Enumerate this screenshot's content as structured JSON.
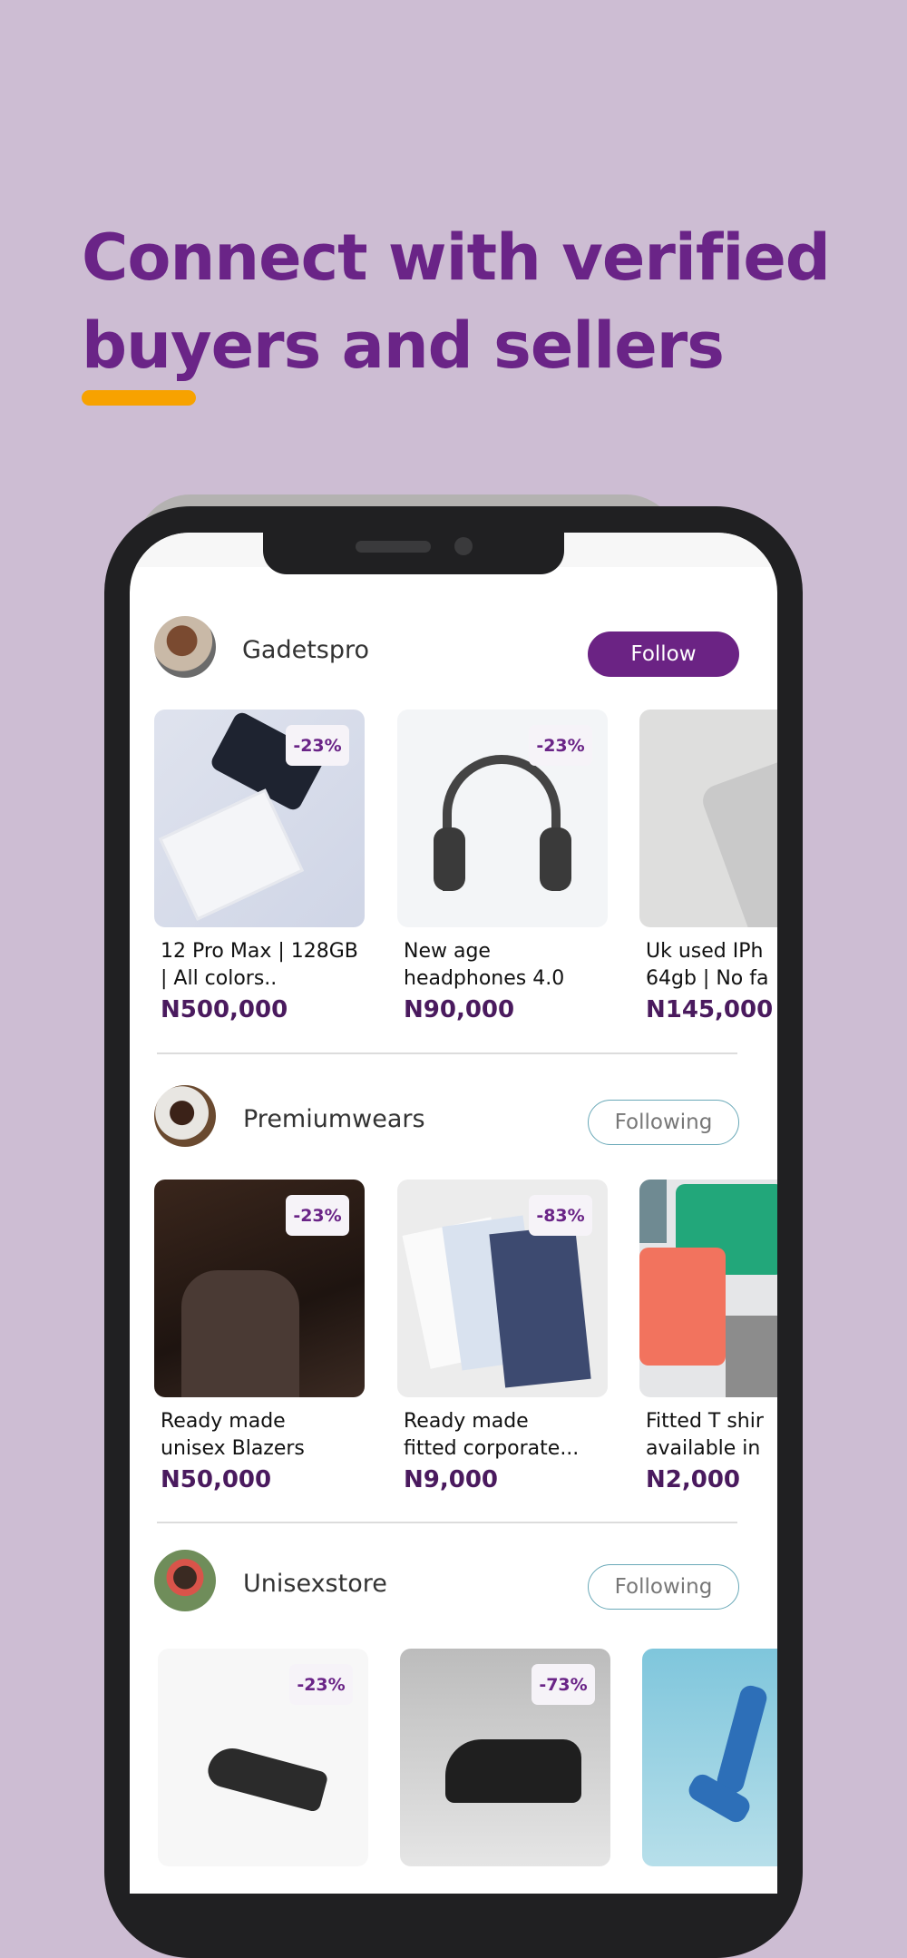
{
  "headline": {
    "line1": "Connect with verified",
    "line2": "buyers and sellers"
  },
  "colors": {
    "background": "#cdbdd3",
    "accent": "#6b2384",
    "underline": "#f7a200",
    "price": "#4a1a5e"
  },
  "stores": [
    {
      "name": "Gadetspro",
      "button": "Follow",
      "button_state": "follow",
      "products": [
        {
          "title1": "12 Pro Max | 128GB",
          "title2": "| All colors..",
          "price": "N500,000",
          "discount": "-23%"
        },
        {
          "title1": "New age",
          "title2": "headphones 4.0",
          "price": "N90,000",
          "discount": "-23%"
        },
        {
          "title1": "Uk used IPh",
          "title2": "64gb | No fa",
          "price": "N145,000",
          "discount": ""
        }
      ]
    },
    {
      "name": "Premiumwears",
      "button": "Following",
      "button_state": "following",
      "products": [
        {
          "title1": "Ready made",
          "title2": "unisex Blazers",
          "price": "N50,000",
          "discount": "-23%"
        },
        {
          "title1": "Ready made",
          "title2": "fitted corporate...",
          "price": "N9,000",
          "discount": "-83%"
        },
        {
          "title1": "Fitted T shir",
          "title2": "available in",
          "price": "N2,000",
          "discount": ""
        }
      ]
    },
    {
      "name": "Unisexstore",
      "button": "Following",
      "button_state": "following",
      "products": [
        {
          "discount": "-23%"
        },
        {
          "discount": "-73%"
        },
        {
          "discount": ""
        }
      ]
    }
  ]
}
